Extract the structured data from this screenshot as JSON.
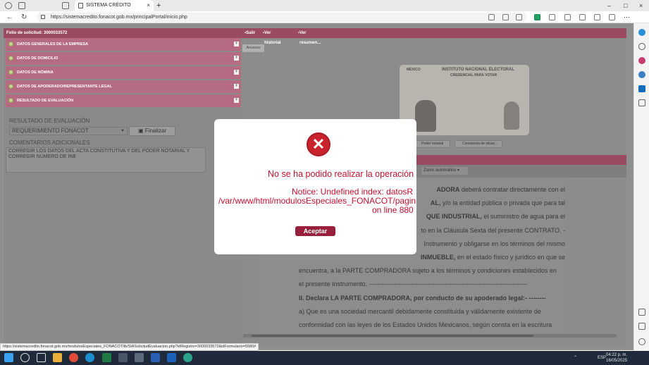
{
  "browser": {
    "tab_title": "SISTEMA CRÉDITO",
    "tab_close": "×",
    "new_tab": "+",
    "url": "https://sistemacredito.fonacot.gob.mx/principalPortal/inicio.php",
    "status_url": "https://sistemacredito.fonacot.gob.mx/modulosEspeciales_FONACOT/tb/SIASolicitudEvaluacion.php?idRegistro=3000033572&idFormulario=5580#",
    "window_controls": [
      "–",
      "□",
      "×"
    ]
  },
  "left_panel": {
    "folio": "Folio de solicitud: 3000033572",
    "sections": [
      {
        "label": "DATOS GENERALES DE LA EMPRESA"
      },
      {
        "label": "DATOS DE DOMICILIO"
      },
      {
        "label": "DATOS DE NÓMINA"
      },
      {
        "label": "DATOS DE APODERADO/REPRESENTANTE LEGAL"
      },
      {
        "label": "RESULTADO DE EVALUACIÓN"
      }
    ],
    "section_toggle": "+",
    "result_label": "RESULTADO DE EVALUACIÓN",
    "result_select_value": "REQUERIMIENTO FONACOT",
    "finalize_label": "Finalizar",
    "comments_label": "COMENTARIOS ADICIONALES",
    "comments_value": "CORREGIR LOS DATOS DEL ACTA CONSTITUTIVA Y DEL PODER NOTARIAL Y CORREGIR NÚMERO DE INE"
  },
  "right_panel": {
    "toolbar": {
      "exit": "Salir",
      "history": "Ver historial",
      "summary": "Ver resumen..."
    },
    "anverso_label": "Anverso",
    "card": {
      "country": "MÉXICO",
      "institute": "INSTITUTO NACIONAL ELECTORAL",
      "subtitle": "CREDENCIAL PARA VOTAR"
    },
    "doc_buttons": [
      "Poder notarial",
      "Constancia de situac..."
    ],
    "zoom_value": "Zoom automático",
    "document_lines": [
      {
        "text": "ADORA deberá contratar directamente con el",
        "bold_prefix": "ADORA"
      },
      {
        "text": "AL, y/o la entidad pública o privada que para tal",
        "bold_prefix": "AL,"
      },
      {
        "text": "QUE INDUSTRIAL, el suministro de agua para el",
        "bold_prefix": "QUE INDUSTRIAL,"
      },
      {
        "text": "to en la Cláusula Sexta del presente CONTRATO. -",
        "bold_prefix": ""
      },
      {
        "text": "Instrumento y obligarse en los términos del mismo",
        "bold_prefix": ""
      },
      {
        "text": "INMUEBLE, en el estado físico y jurídico en que se",
        "bold_prefix": "INMUEBLE,"
      },
      {
        "text": "encuentra, a la PARTE COMPRADORA sujeto a los términos y condiciones establecidos en",
        "bold_prefix": ""
      },
      {
        "text": "el presente Instrumento. ---------------------------------------------------------------------------",
        "bold_prefix": ""
      },
      {
        "text": "II. Declara LA PARTE COMPRADORA, por conducto de su apoderado legal:- --------",
        "bold_prefix": "all"
      },
      {
        "text": "a) Que es una sociedad mercantil debidamente constituida y válidamente existente de",
        "bold_prefix": ""
      },
      {
        "text": "conformidad con las leyes de los Estados Unidos Mexicanos, según consta en la escritura",
        "bold_prefix": ""
      }
    ]
  },
  "modal": {
    "title": "No se ha podido realizar la operación de",
    "notice_line1": "Notice: Undefined index: datosR",
    "notice_line2": "/var/www/html/modulosEspeciales_FONACOT/pagin",
    "notice_line3": "on line 880",
    "ok_label": "Aceptar",
    "icon_glyph": "✕"
  },
  "taskbar": {
    "time": "04:22 p. m.",
    "date": "16/05/2025",
    "lang": "ESP"
  },
  "colors": {
    "brand": "#9a4b62",
    "section": "#b56c82",
    "error": "#c8102e",
    "ok_button": "#99203a"
  }
}
